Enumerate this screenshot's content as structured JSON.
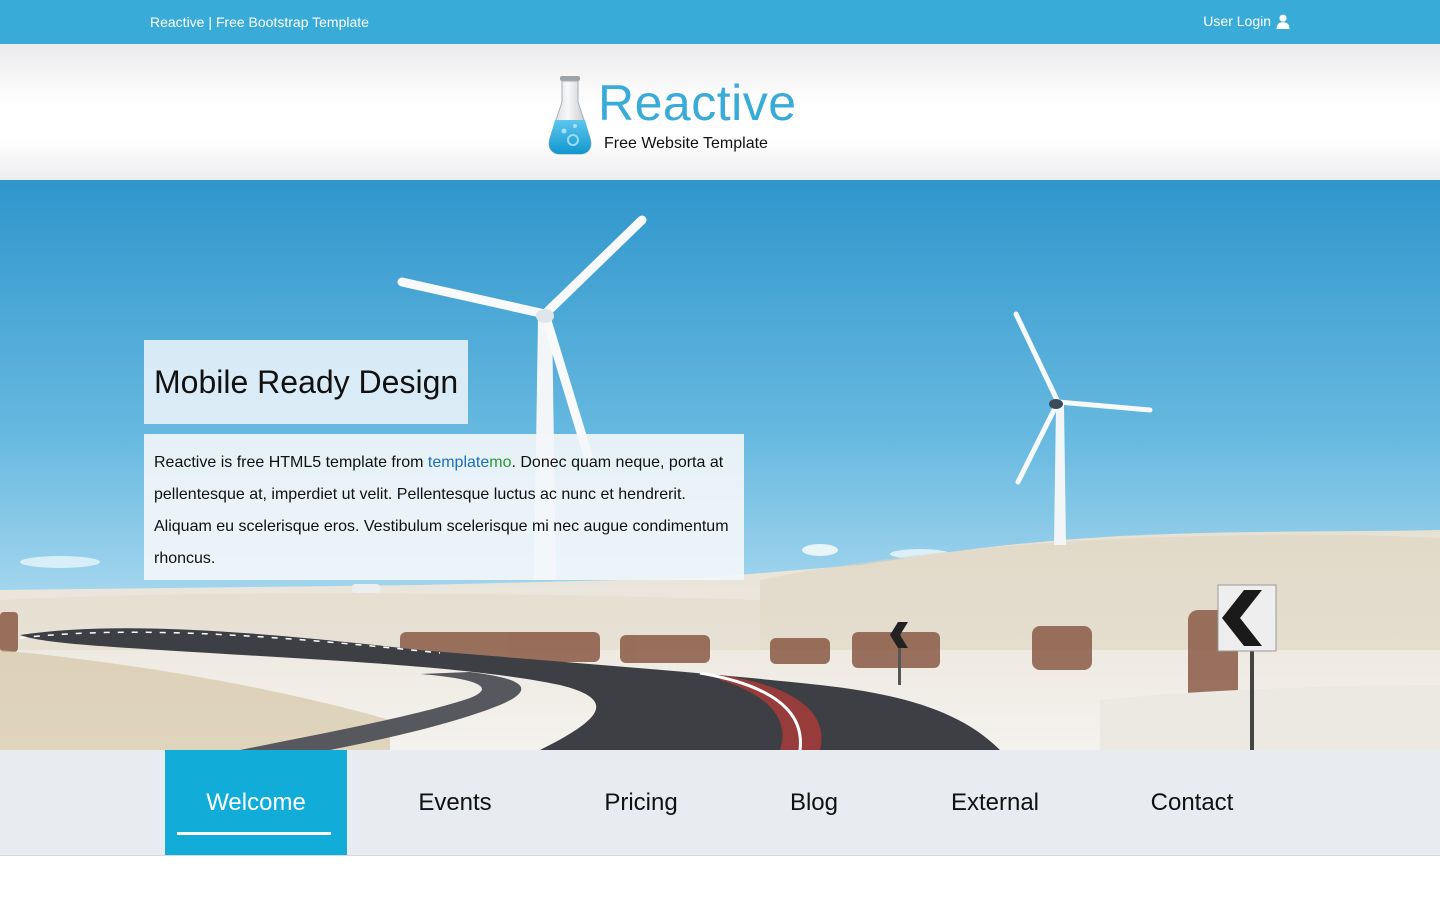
{
  "topbar": {
    "site_title": "Reactive | Free Bootstrap Template",
    "login_label": "User Login",
    "login_icon": "user-icon"
  },
  "header": {
    "brand_name": "Reactive",
    "tagline": "Free Website Template",
    "logo_icon": "flask-icon"
  },
  "hero": {
    "slide_title": "Mobile Ready Design",
    "text_before": "Reactive is free HTML5 template from ",
    "link_part1": "template",
    "link_part2": "mo",
    "text_after": ". Donec quam neque, porta at pellentesque at, imperdiet ut velit. Pellentesque luctus ac nunc et hendrerit. Aliquam eu scelerisque eros. Vestibulum scelerisque mi nec augue condimentum rhoncus."
  },
  "nav": {
    "active_index": 0,
    "tabs": [
      "Welcome",
      "Events",
      "Pricing",
      "Blog",
      "External",
      "Contact"
    ]
  },
  "colors": {
    "accent": "#38abd9",
    "nav_active": "#12acd9",
    "nav_bg": "#e8ebef",
    "link_blue": "#1a6fbd",
    "link_green": "#2b9a30"
  }
}
